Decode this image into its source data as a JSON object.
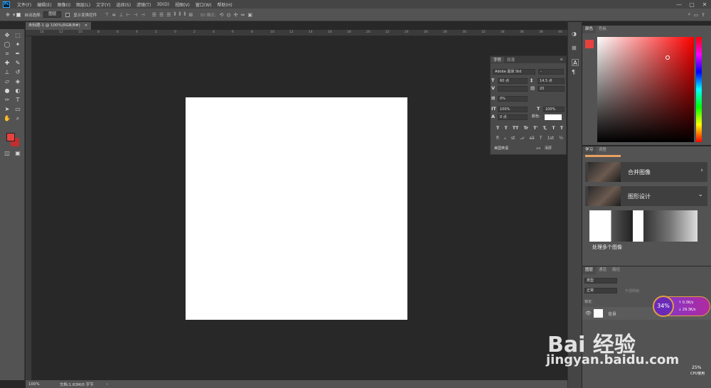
{
  "app": {
    "logo": "Ps"
  },
  "menu": [
    "文件(F)",
    "编辑(E)",
    "图像(I)",
    "图层(L)",
    "文字(Y)",
    "选择(S)",
    "滤镜(T)",
    "3D(D)",
    "视图(V)",
    "窗口(W)",
    "帮助(H)"
  ],
  "window_controls": {
    "minimize": "—",
    "restore": "▢",
    "close": "✕"
  },
  "options": {
    "auto_select_label": "自动选择:",
    "auto_select_value": "图层",
    "transform_label": "显示变换控件",
    "mode_3d": "3D 模式:"
  },
  "document": {
    "tab_label": "未标题-1 @ 100%(RGB/8#)",
    "tab_close": "×",
    "zoom": "100%",
    "doc_info": "文档:1.83M/0 字节"
  },
  "ruler_ticks": [
    "14",
    "12",
    "10",
    "8",
    "6",
    "4",
    "2",
    "0",
    "2",
    "4",
    "6",
    "8",
    "10",
    "12",
    "14",
    "16",
    "18",
    "20",
    "22",
    "24",
    "26",
    "28",
    "30",
    "32",
    "34",
    "36",
    "38",
    "40"
  ],
  "character_panel": {
    "tabs": [
      "字符",
      "段落"
    ],
    "font_family": "Adobe 黑体 Std",
    "font_style": "-",
    "font_size": "60 点",
    "leading": "14.5 点",
    "kerning": "",
    "tracking": "20",
    "scale_pct": "0%",
    "vertical_scale": "100%",
    "horizontal_scale": "100%",
    "baseline": "0 点",
    "color_label": "颜色:",
    "style_buttons": [
      "T",
      "T",
      "TT",
      "Tr",
      "T'",
      "T,",
      "T",
      "T"
    ],
    "lang": "美国英语",
    "aa_mode": "浑厚",
    "aa_prefix": "aa"
  },
  "color_panel": {
    "tabs": [
      "颜色",
      "色板"
    ],
    "fg_color": "#e8423f",
    "bg_color": "#c42d2d"
  },
  "learn_panel": {
    "tabs": [
      "学习",
      "调整"
    ],
    "cards": [
      {
        "title": "合并图像",
        "chevron": "›"
      },
      {
        "title": "图形设计",
        "chevron": "⌄"
      }
    ],
    "sub_item": "处理多个图像"
  },
  "layers_panel": {
    "tabs": [
      "图层",
      "通道",
      "路径"
    ],
    "search": "类型",
    "mode": "正常",
    "opacity": "不透明度:",
    "lock": "锁定:",
    "layer_name": "背景",
    "badge_pct": "34%",
    "badge_up": "↑ 0.3K/s",
    "badge_down": "↓ 29.3K/s",
    "small_pct": "25%",
    "small_label": "CPU使用"
  },
  "watermark": {
    "text": "Bai 经验",
    "url": "jingyan.baidu.com"
  }
}
